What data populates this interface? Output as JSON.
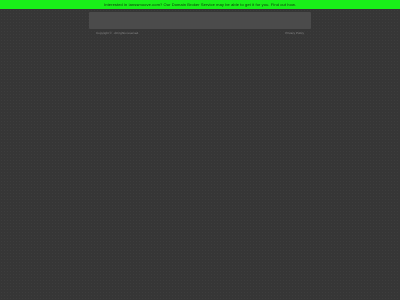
{
  "banner": {
    "text": "Interested in ianssmoove.com? Our Domain Broker Service may be able to get it for you. Find out how."
  },
  "footer": {
    "copyright": "Copyright © . All rights reserved.",
    "privacy_label": "Privacy Policy"
  },
  "colors": {
    "background": "#363636",
    "banner": "#19ef19",
    "panel": "#4b4b4b",
    "footer_text": "#8a8a8a"
  }
}
